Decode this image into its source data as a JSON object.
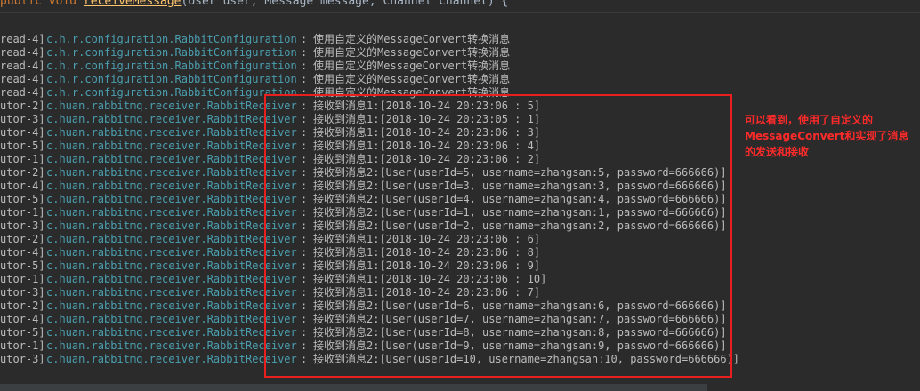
{
  "code": {
    "line": "public void receiveMessage(User user, Message message, Channel channel) {"
  },
  "log_rows": [
    {
      "thread": "read-4]",
      "logger": "c.h.r.configuration.RabbitConfiguration",
      "sep": ":",
      "msg": "使用自定义的MessageConvert转换消息"
    },
    {
      "thread": "read-4]",
      "logger": "c.h.r.configuration.RabbitConfiguration",
      "sep": ":",
      "msg": "使用自定义的MessageConvert转换消息"
    },
    {
      "thread": "read-4]",
      "logger": "c.h.r.configuration.RabbitConfiguration",
      "sep": ":",
      "msg": "使用自定义的MessageConvert转换消息"
    },
    {
      "thread": "read-4]",
      "logger": "c.h.r.configuration.RabbitConfiguration",
      "sep": ":",
      "msg": "使用自定义的MessageConvert转换消息"
    },
    {
      "thread": "read-4]",
      "logger": "c.h.r.configuration.RabbitConfiguration",
      "sep": ":",
      "msg": "使用自定义的MessageConvert转换消息"
    },
    {
      "thread": "utor-2]",
      "logger": "c.huan.rabbitmq.receiver.RabbitReceiver",
      "sep": ":",
      "msg": "接收到消息1:[2018-10-24 20:23:06 : 5]"
    },
    {
      "thread": "utor-3]",
      "logger": "c.huan.rabbitmq.receiver.RabbitReceiver",
      "sep": ":",
      "msg": "接收到消息1:[2018-10-24 20:23:05 : 1]"
    },
    {
      "thread": "utor-4]",
      "logger": "c.huan.rabbitmq.receiver.RabbitReceiver",
      "sep": ":",
      "msg": "接收到消息1:[2018-10-24 20:23:06 : 3]"
    },
    {
      "thread": "utor-5]",
      "logger": "c.huan.rabbitmq.receiver.RabbitReceiver",
      "sep": ":",
      "msg": "接收到消息1:[2018-10-24 20:23:06 : 4]"
    },
    {
      "thread": "utor-1]",
      "logger": "c.huan.rabbitmq.receiver.RabbitReceiver",
      "sep": ":",
      "msg": "接收到消息1:[2018-10-24 20:23:06 : 2]"
    },
    {
      "thread": "utor-2]",
      "logger": "c.huan.rabbitmq.receiver.RabbitReceiver",
      "sep": ":",
      "msg": "接收到消息2:[User(userId=5, username=zhangsan:5, password=666666)]"
    },
    {
      "thread": "utor-4]",
      "logger": "c.huan.rabbitmq.receiver.RabbitReceiver",
      "sep": ":",
      "msg": "接收到消息2:[User(userId=3, username=zhangsan:3, password=666666)]"
    },
    {
      "thread": "utor-5]",
      "logger": "c.huan.rabbitmq.receiver.RabbitReceiver",
      "sep": ":",
      "msg": "接收到消息2:[User(userId=4, username=zhangsan:4, password=666666)]"
    },
    {
      "thread": "utor-1]",
      "logger": "c.huan.rabbitmq.receiver.RabbitReceiver",
      "sep": ":",
      "msg": "接收到消息2:[User(userId=1, username=zhangsan:1, password=666666)]"
    },
    {
      "thread": "utor-3]",
      "logger": "c.huan.rabbitmq.receiver.RabbitReceiver",
      "sep": ":",
      "msg": "接收到消息2:[User(userId=2, username=zhangsan:2, password=666666)]"
    },
    {
      "thread": "utor-2]",
      "logger": "c.huan.rabbitmq.receiver.RabbitReceiver",
      "sep": ":",
      "msg": "接收到消息1:[2018-10-24 20:23:06 : 6]"
    },
    {
      "thread": "utor-4]",
      "logger": "c.huan.rabbitmq.receiver.RabbitReceiver",
      "sep": ":",
      "msg": "接收到消息1:[2018-10-24 20:23:06 : 8]"
    },
    {
      "thread": "utor-5]",
      "logger": "c.huan.rabbitmq.receiver.RabbitReceiver",
      "sep": ":",
      "msg": "接收到消息1:[2018-10-24 20:23:06 : 9]"
    },
    {
      "thread": "utor-1]",
      "logger": "c.huan.rabbitmq.receiver.RabbitReceiver",
      "sep": ":",
      "msg": "接收到消息1:[2018-10-24 20:23:06 : 10]"
    },
    {
      "thread": "utor-3]",
      "logger": "c.huan.rabbitmq.receiver.RabbitReceiver",
      "sep": ":",
      "msg": "接收到消息1:[2018-10-24 20:23:06 : 7]"
    },
    {
      "thread": "utor-2]",
      "logger": "c.huan.rabbitmq.receiver.RabbitReceiver",
      "sep": ":",
      "msg": "接收到消息2:[User(userId=6, username=zhangsan:6, password=666666)]"
    },
    {
      "thread": "utor-4]",
      "logger": "c.huan.rabbitmq.receiver.RabbitReceiver",
      "sep": ":",
      "msg": "接收到消息2:[User(userId=7, username=zhangsan:7, password=666666)]"
    },
    {
      "thread": "utor-5]",
      "logger": "c.huan.rabbitmq.receiver.RabbitReceiver",
      "sep": ":",
      "msg": "接收到消息2:[User(userId=8, username=zhangsan:8, password=666666)]"
    },
    {
      "thread": "utor-1]",
      "logger": "c.huan.rabbitmq.receiver.RabbitReceiver",
      "sep": ":",
      "msg": "接收到消息2:[User(userId=9, username=zhangsan:9, password=666666)]"
    },
    {
      "thread": "utor-3]",
      "logger": "c.huan.rabbitmq.receiver.RabbitReceiver",
      "sep": ":",
      "msg": "接收到消息2:[User(userId=10, username=zhangsan:10, password=666666)]"
    }
  ],
  "annotation": {
    "text": "可以看到，使用了自定义的MessageConvert和实现了消息的发送和接收",
    "color": "#ff2a2a"
  },
  "colors": {
    "background": "#2b2b2b",
    "logger": "#4a9fb0",
    "highlight_border": "#e81f1f"
  }
}
